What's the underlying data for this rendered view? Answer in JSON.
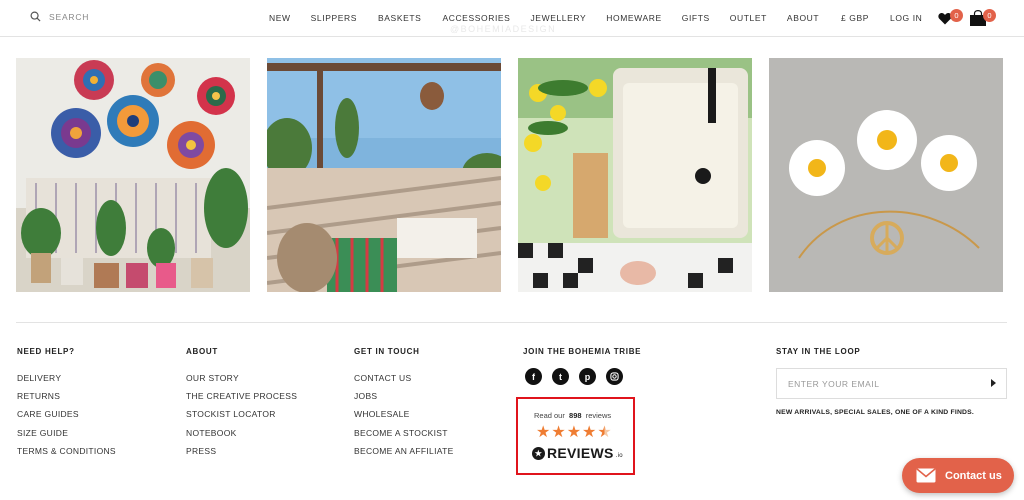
{
  "header": {
    "search_placeholder": "SEARCH",
    "nav": [
      "NEW",
      "SLIPPERS",
      "BASKETS",
      "ACCESSORIES",
      "JEWELLERY",
      "HOMEWARE",
      "GIFTS",
      "OUTLET",
      "ABOUT"
    ],
    "currency": "£ GBP",
    "login": "LOG IN",
    "wishlist_count": "0",
    "cart_count": "0",
    "ghost_text": "@BOHEMIADESIGN",
    "accent_color": "#e2624a"
  },
  "footer": {
    "need_help": {
      "heading": "NEED HELP?",
      "links": [
        "DELIVERY",
        "RETURNS",
        "CARE GUIDES",
        "SIZE GUIDE",
        "TERMS & CONDITIONS"
      ]
    },
    "about": {
      "heading": "ABOUT",
      "links": [
        "OUR STORY",
        "THE CREATIVE PROCESS",
        "STOCKIST LOCATOR",
        "NOTEBOOK",
        "PRESS"
      ]
    },
    "get_in_touch": {
      "heading": "GET IN TOUCH",
      "links": [
        "CONTACT US",
        "JOBS",
        "WHOLESALE",
        "BECOME A STOCKIST",
        "BECOME AN AFFILIATE"
      ]
    },
    "tribe": {
      "heading": "JOIN THE BOHEMIA TRIBE",
      "social_icons": [
        "facebook-icon",
        "twitter-icon",
        "pinterest-icon",
        "instagram-icon"
      ],
      "reviews_prefix": "Read our",
      "reviews_count": "898",
      "reviews_suffix": "reviews",
      "rating_stars": 4.5,
      "reviews_brand": "REVIEWS",
      "reviews_brand_suffix": ".io"
    },
    "newsletter": {
      "heading": "STAY IN THE LOOP",
      "placeholder": "ENTER YOUR EMAIL",
      "note": "NEW ARRIVALS, SPECIAL SALES, ONE OF A KIND FINDS."
    }
  },
  "contact_button": "Contact us"
}
